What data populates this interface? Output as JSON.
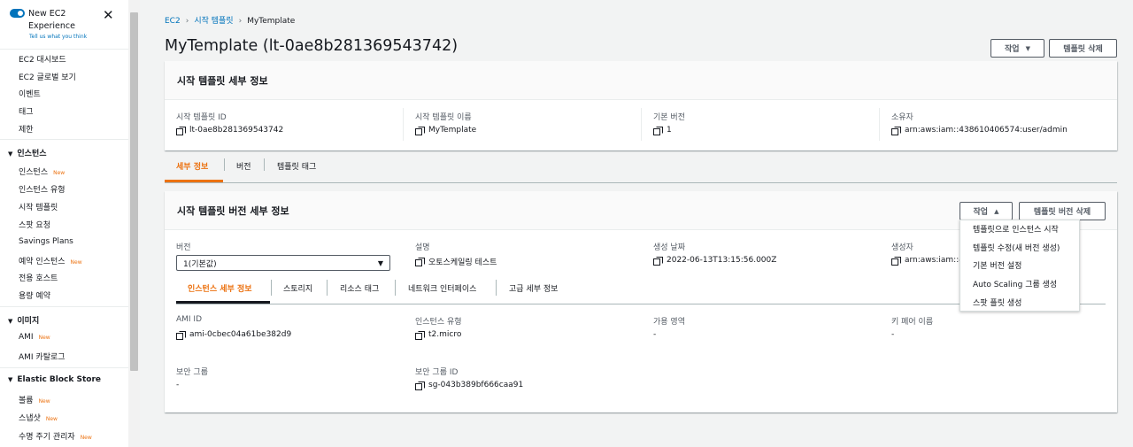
{
  "sidebar": {
    "experience_title": "New EC2 Experience",
    "experience_link": "Tell us what you think",
    "new_badge": "New",
    "top_items": [
      "EC2 대시보드",
      "EC2 글로벌 보기",
      "이벤트",
      "태그",
      "제한"
    ],
    "sections": [
      {
        "title": "인스턴스",
        "items": [
          {
            "label": "인스턴스",
            "new": true
          },
          {
            "label": "인스턴스 유형",
            "new": false
          },
          {
            "label": "시작 템플릿",
            "new": false
          },
          {
            "label": "스팟 요청",
            "new": false
          },
          {
            "label": "Savings Plans",
            "new": false
          },
          {
            "label": "예약 인스턴스",
            "new": true
          },
          {
            "label": "전용 호스트",
            "new": false
          },
          {
            "label": "용량 예약",
            "new": false
          }
        ]
      },
      {
        "title": "이미지",
        "items": [
          {
            "label": "AMI",
            "new": true
          },
          {
            "label": "AMI 카탈로그",
            "new": false
          }
        ]
      },
      {
        "title": "Elastic Block Store",
        "items": [
          {
            "label": "볼륨",
            "new": true
          },
          {
            "label": "스냅샷",
            "new": true
          },
          {
            "label": "수명 주기 관리자",
            "new": true
          }
        ]
      }
    ]
  },
  "breadcrumb": [
    "EC2",
    "시작 템플릿",
    "MyTemplate"
  ],
  "page": {
    "title": "MyTemplate (lt-0ae8b281369543742)",
    "actions_label": "작업",
    "delete_label": "템플릿 삭제"
  },
  "details": {
    "title": "시작 템플릿 세부 정보",
    "fields": [
      {
        "label": "시작 템플릿 ID",
        "value": "lt-0ae8b281369543742"
      },
      {
        "label": "시작 템플릿 이름",
        "value": "MyTemplate"
      },
      {
        "label": "기본 버전",
        "value": "1"
      },
      {
        "label": "소유자",
        "value": "arn:aws:iam::438610406574:user/admin"
      }
    ]
  },
  "tabs": [
    "세부 정보",
    "버전",
    "템플릿 태그"
  ],
  "version": {
    "title": "시작 템플릿 버전 세부 정보",
    "actions_label": "작업",
    "delete_label": "템플릿 버전 삭제",
    "version_label": "버전",
    "version_selected": "1(기본값)",
    "desc_label": "설명",
    "desc_value": "오토스케일링 테스트",
    "created_label": "생성 날짜",
    "created_value": "2022-06-13T13:15:56.000Z",
    "creator_label": "생성자",
    "creator_value": "arn:aws:iam::43",
    "subtabs": [
      "인스턴스 세부 정보",
      "스토리지",
      "리소스 태그",
      "네트워크 인터페이스",
      "고급 세부 정보"
    ],
    "instance": {
      "ami_label": "AMI ID",
      "ami_value": "ami-0cbec04a61be382d9",
      "type_label": "인스턴스 유형",
      "type_value": "t2.micro",
      "az_label": "가용 영역",
      "az_value": "-",
      "key_label": "키 페어 이름",
      "key_value": "-",
      "sg_label": "보안 그룹",
      "sg_value": "-",
      "sgid_label": "보안 그룹 ID",
      "sgid_value": "sg-043b389bf666caa91"
    }
  },
  "dropdown_items": [
    "템플릿으로 인스턴스 시작",
    "템플릿 수정(새 버전 생성)",
    "기본 버전 설정",
    "Auto Scaling 그룹 생성",
    "스팟 플릿 생성"
  ]
}
